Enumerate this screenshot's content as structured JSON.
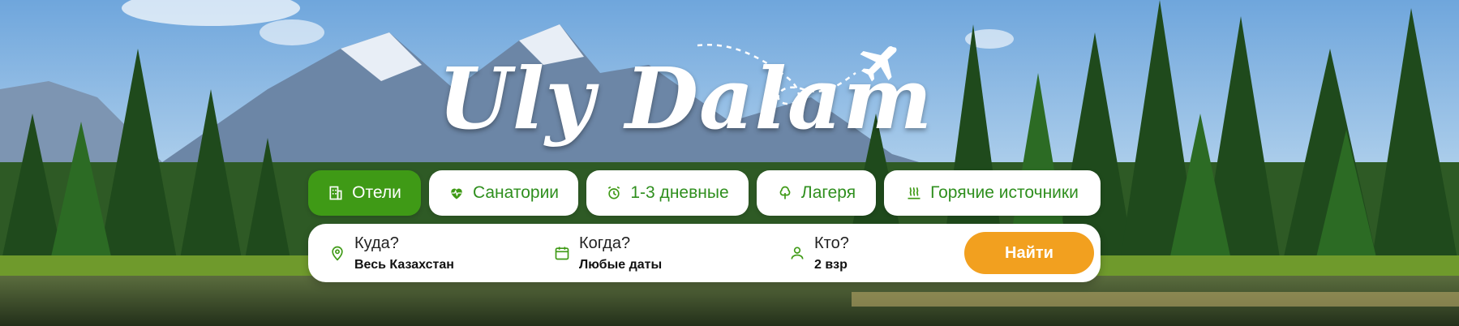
{
  "brand": {
    "logo_text": "Uly Dalam"
  },
  "tabs": [
    {
      "label": "Отели",
      "icon": "building-icon",
      "active": true
    },
    {
      "label": "Санатории",
      "icon": "heart-pulse-icon",
      "active": false
    },
    {
      "label": "1-3 дневные",
      "icon": "alarm-clock-icon",
      "active": false
    },
    {
      "label": "Лагеря",
      "icon": "tree-icon",
      "active": false
    },
    {
      "label": "Горячие источники",
      "icon": "hot-springs-icon",
      "active": false
    }
  ],
  "search": {
    "where": {
      "title": "Куда?",
      "value": "Весь Казахстан",
      "icon": "location-pin-icon"
    },
    "when": {
      "title": "Когда?",
      "value": "Любые даты",
      "icon": "calendar-icon"
    },
    "who": {
      "title": "Кто?",
      "value": "2 взр",
      "icon": "user-icon"
    },
    "button_label": "Найти"
  },
  "colors": {
    "accent_green": "#3f9a16",
    "tab_text_green": "#2f8f1e",
    "search_button": "#f2a01f"
  }
}
